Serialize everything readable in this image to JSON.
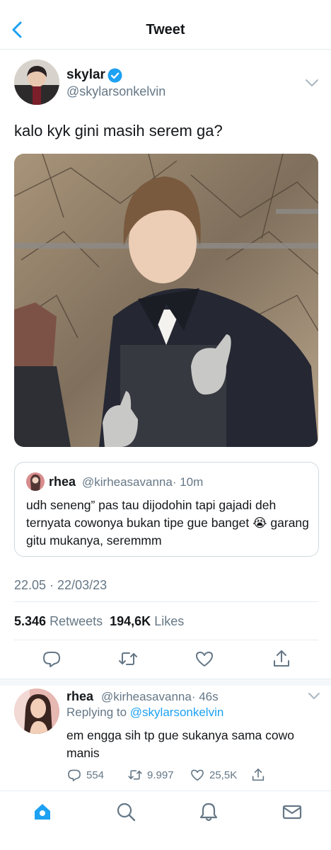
{
  "header": {
    "title": "Tweet",
    "back_icon": "chevron-left-icon"
  },
  "tweet": {
    "author": {
      "name": "skylar",
      "handle": "@skylarsonkelvin",
      "verified": true
    },
    "text": "kalo kyk gini masih serem ga?",
    "photo": {
      "description_icon": "photo"
    },
    "quote": {
      "name": "rhea",
      "handle": "@kirheasavanna",
      "time": "· 10m",
      "text": "udh seneng” pas tau dijodohin tapi gajadi deh ternyata cowonya bukan tipe gue banget 😭 garang gitu mukanya, seremmm"
    },
    "timestamp": "22.05 · 22/03/23",
    "stats": {
      "retweets_count": "5.346",
      "retweets_label": "Retweets",
      "likes_count": "194,6K",
      "likes_label": "Likes"
    }
  },
  "reply": {
    "name": "rhea",
    "handle": "@kirheasavanna",
    "time": "· 46s",
    "replying_prefix": "Replying to",
    "replying_to": "@skylarsonkelvin",
    "text": "em engga sih tp gue sukanya sama cowo manis",
    "replies": "554",
    "retweets": "9.997",
    "likes": "25,5K"
  },
  "nav": {
    "items": [
      "home-icon",
      "search-icon",
      "bell-icon",
      "mail-icon"
    ]
  },
  "colors": {
    "accent": "#1da1f2",
    "text": "#14171a",
    "muted": "#657786",
    "border": "#e6ecf0"
  }
}
